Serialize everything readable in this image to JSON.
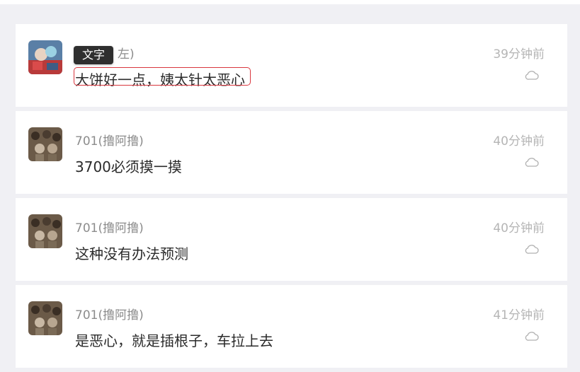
{
  "feed": {
    "items": [
      {
        "author_visible": "左)",
        "content": "大饼好一点，姨太针太恶心",
        "time": "39分钟前",
        "icon": "comment-icon",
        "tooltip": "文字"
      },
      {
        "author": "701(撸阿撸)",
        "content": "3700必须摸一摸",
        "time": "40分钟前",
        "icon": "comment-icon"
      },
      {
        "author": "701(撸阿撸)",
        "content": "这种没有办法预测",
        "time": "40分钟前",
        "icon": "comment-icon"
      },
      {
        "author": "701(撸阿撸)",
        "content": "是恶心，就是插根子，车拉上去",
        "time": "41分钟前",
        "icon": "comment-icon"
      }
    ]
  },
  "colors": {
    "background": "#f0f0f4",
    "card": "#ffffff",
    "highlight": "#d9363e",
    "tooltip_bg": "#2f2f2f",
    "meta_text": "#8c8c8c",
    "time_text": "#b5b5b5"
  }
}
